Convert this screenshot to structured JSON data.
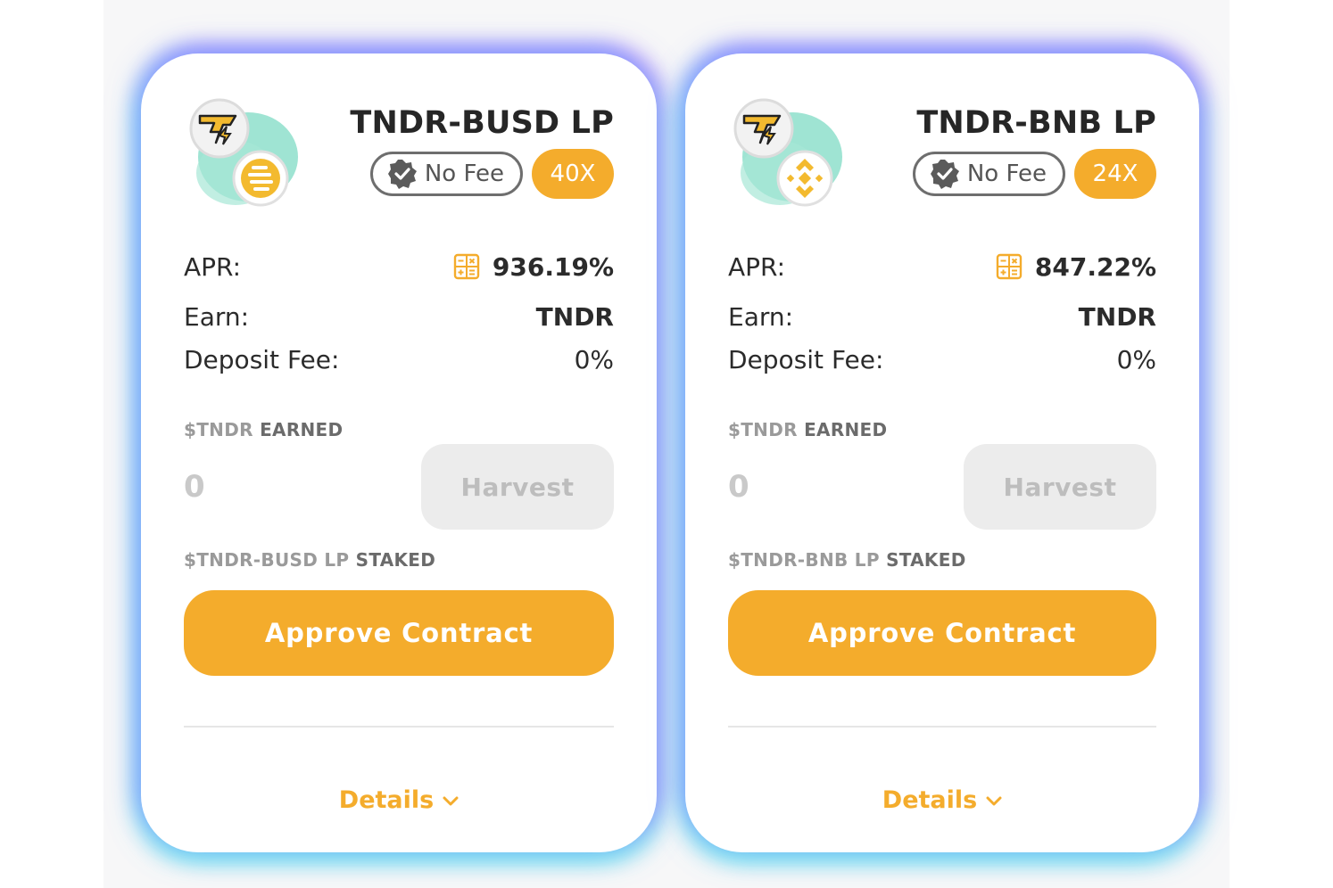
{
  "colors": {
    "accent": "#f4ac2c",
    "muted": "#9a9a9a",
    "text": "#2b2b2b",
    "tndr_teal": "#7fd9c4",
    "bnb_gold": "#f3ba2f"
  },
  "farms": [
    {
      "title": "TNDR-BUSD LP",
      "fee_tag": "No Fee",
      "multiplier": "40X",
      "apr_label": "APR:",
      "apr_value": "936.19%",
      "earn_label": "Earn:",
      "earn_value": "TNDR",
      "deposit_label": "Deposit Fee:",
      "deposit_value": "0%",
      "earned_token": "$TNDR",
      "earned_word": "EARNED",
      "earned_amount": "0",
      "harvest_label": "Harvest",
      "staked_token": "$TNDR-BUSD LP",
      "staked_word": "STAKED",
      "approve_label": "Approve Contract",
      "details_label": "Details",
      "quote_icon": "busd-icon"
    },
    {
      "title": "TNDR-BNB LP",
      "fee_tag": "No Fee",
      "multiplier": "24X",
      "apr_label": "APR:",
      "apr_value": "847.22%",
      "earn_label": "Earn:",
      "earn_value": "TNDR",
      "deposit_label": "Deposit Fee:",
      "deposit_value": "0%",
      "earned_token": "$TNDR",
      "earned_word": "EARNED",
      "earned_amount": "0",
      "harvest_label": "Harvest",
      "staked_token": "$TNDR-BNB LP",
      "staked_word": "STAKED",
      "approve_label": "Approve Contract",
      "details_label": "Details",
      "quote_icon": "bnb-icon"
    }
  ]
}
